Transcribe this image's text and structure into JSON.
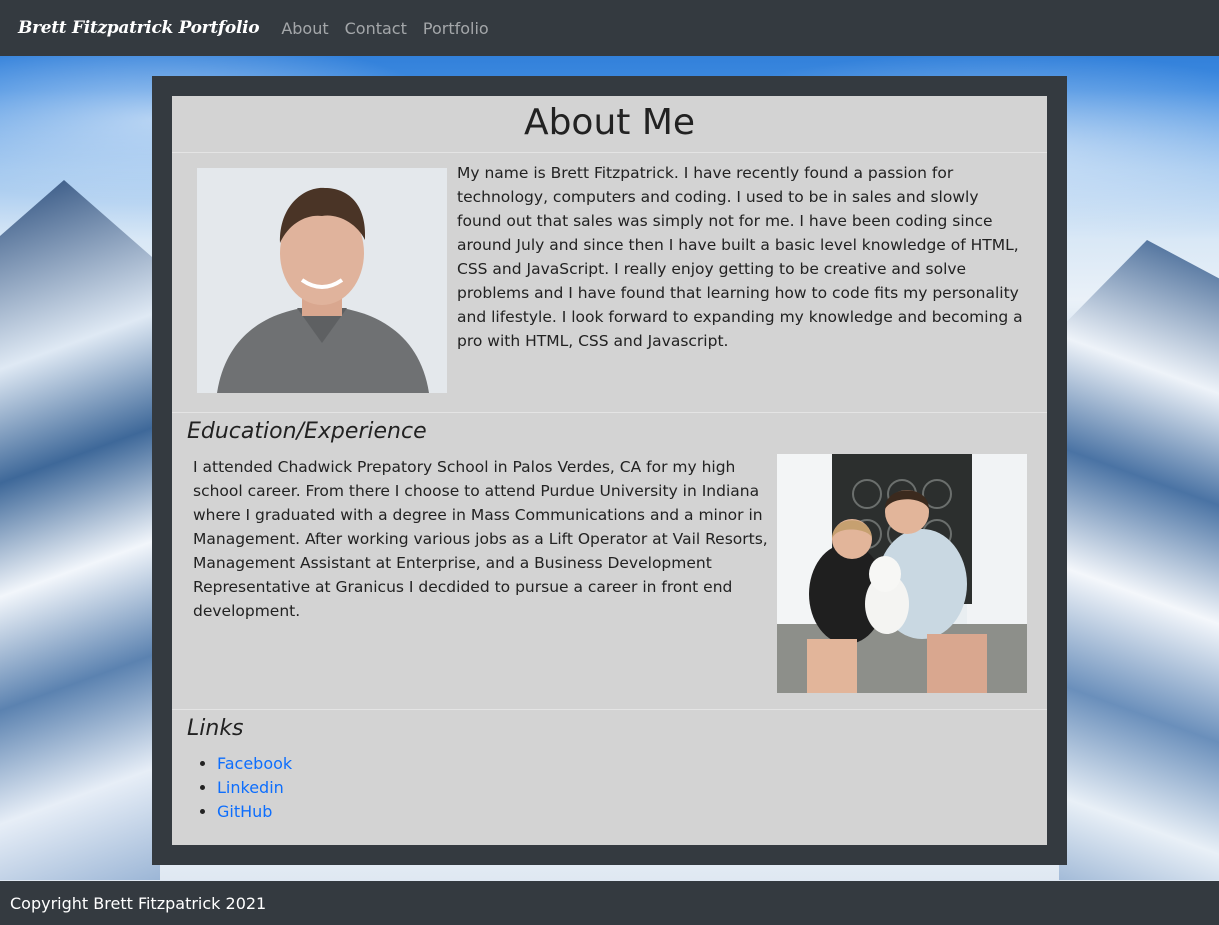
{
  "navbar": {
    "brand": "Brett Fitzpatrick Portfolio",
    "links": [
      "About",
      "Contact",
      "Portfolio"
    ]
  },
  "card": {
    "title": "About Me",
    "about_text": "My name is Brett Fitzpatrick. I have recently found a passion for technology, computers and coding. I used to be in sales and slowly found out that sales was simply not for me. I have been coding since around July and since then I have built a basic level knowledge of HTML, CSS and JavaScript. I really enjoy getting to be creative and solve problems and I have found that learning how to code fits my personality and lifestyle. I look forward to expanding my knowledge and becoming a pro with HTML, CSS and Javascript.",
    "education": {
      "title": "Education/Experience",
      "text": "I attended Chadwick Prepatory School in Palos Verdes, CA for my high school career. From there I choose to attend Purdue University in Indiana where I graduated with a degree in Mass Communications and a minor in Management. After working various jobs as a Lift Operator at Vail Resorts, Management Assistant at Enterprise, and a Business Development Representative at Granicus I decdided to pursue a career in front end development."
    },
    "links": {
      "title": "Links",
      "items": [
        "Facebook",
        "Linkedin",
        "GitHub"
      ]
    }
  },
  "footer": {
    "text": "Copyright Brett Fitzpatrick 2021"
  },
  "colors": {
    "navbar_bg": "#343a40",
    "card_bg": "#d3d3d3",
    "link": "#0d6efd"
  }
}
